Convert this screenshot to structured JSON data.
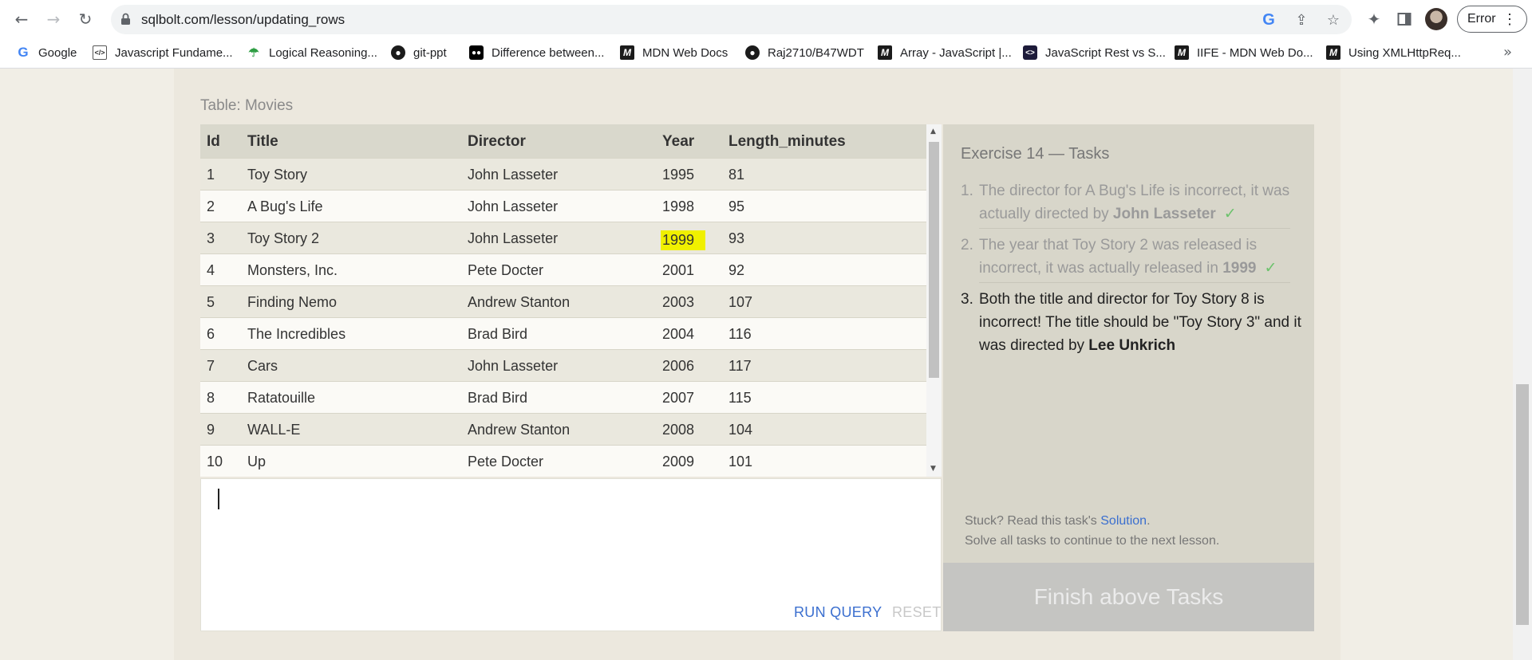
{
  "browser": {
    "url": "sqlbolt.com/lesson/updating_rows",
    "profile_chip": "Error",
    "icons": [
      "back-arrow-icon",
      "forward-arrow-icon",
      "reload-icon",
      "lock-icon",
      "google-icon",
      "share-icon",
      "star-icon",
      "extensions-icon",
      "side-panel-icon",
      "avatar",
      "more-vert-icon"
    ]
  },
  "bookmarks": [
    {
      "label": "Google",
      "icon": "google-icon"
    },
    {
      "label": "Javascript Fundame...",
      "icon": "code-icon"
    },
    {
      "label": "Logical Reasoning...",
      "icon": "umbrella-icon"
    },
    {
      "label": "git-ppt",
      "icon": "github-icon"
    },
    {
      "label": "Difference between...",
      "icon": "medium-icon"
    },
    {
      "label": "MDN Web Docs",
      "icon": "mdn-icon"
    },
    {
      "label": "Raj2710/B47WDT",
      "icon": "github-icon"
    },
    {
      "label": "Array - JavaScript |...",
      "icon": "mdn-icon"
    },
    {
      "label": "JavaScript Rest vs S...",
      "icon": "js-icon"
    },
    {
      "label": "IIFE - MDN Web Do...",
      "icon": "mdn-icon"
    },
    {
      "label": "Using XMLHttpReq...",
      "icon": "mdn-icon"
    }
  ],
  "table": {
    "caption": "Table: Movies",
    "columns": [
      "Id",
      "Title",
      "Director",
      "Year",
      "Length_minutes"
    ],
    "rows": [
      [
        "1",
        "Toy Story",
        "John Lasseter",
        "1995",
        "81"
      ],
      [
        "2",
        "A Bug's Life",
        "John Lasseter",
        "1998",
        "95"
      ],
      [
        "3",
        "Toy Story 2",
        "John Lasseter",
        "1999",
        "93"
      ],
      [
        "4",
        "Monsters, Inc.",
        "Pete Docter",
        "2001",
        "92"
      ],
      [
        "5",
        "Finding Nemo",
        "Andrew Stanton",
        "2003",
        "107"
      ],
      [
        "6",
        "The Incredibles",
        "Brad Bird",
        "2004",
        "116"
      ],
      [
        "7",
        "Cars",
        "John Lasseter",
        "2006",
        "117"
      ],
      [
        "8",
        "Ratatouille",
        "Brad Bird",
        "2007",
        "115"
      ],
      [
        "9",
        "WALL-E",
        "Andrew Stanton",
        "2008",
        "104"
      ],
      [
        "10",
        "Up",
        "Pete Docter",
        "2009",
        "101"
      ]
    ],
    "highlight_color": "#f0f000"
  },
  "editor": {
    "value": "",
    "run_label": "RUN QUERY",
    "reset_label": "RESET"
  },
  "tasks": {
    "title": "Exercise 14 — Tasks",
    "items": [
      {
        "num": "1.",
        "pre": "The director for A Bug's Life is incorrect, it was actually directed by ",
        "bold": "John Lasseter",
        "check": "✓",
        "done": true
      },
      {
        "num": "2.",
        "pre": "The year that Toy Story 2 was released is incorrect, it was actually released in ",
        "bold": "1999",
        "check": "✓",
        "done": true
      },
      {
        "num": "3.",
        "pre": "Both the title and director for Toy Story 8 is incorrect! The title should be \"Toy Story 3\" and it was directed by ",
        "bold": "Lee Unkrich",
        "check": "",
        "done": false
      }
    ],
    "stuck_pre": "Stuck? Read this task's ",
    "solution_link": "Solution",
    "stuck_post": ".",
    "solve_note": "Solve all tasks to continue to the next lesson.",
    "finish_label": "Finish above Tasks"
  },
  "colors": {
    "link": "#3b6fcf",
    "check": "#6cc26c",
    "finish_disabled": "#c5c5c2"
  }
}
